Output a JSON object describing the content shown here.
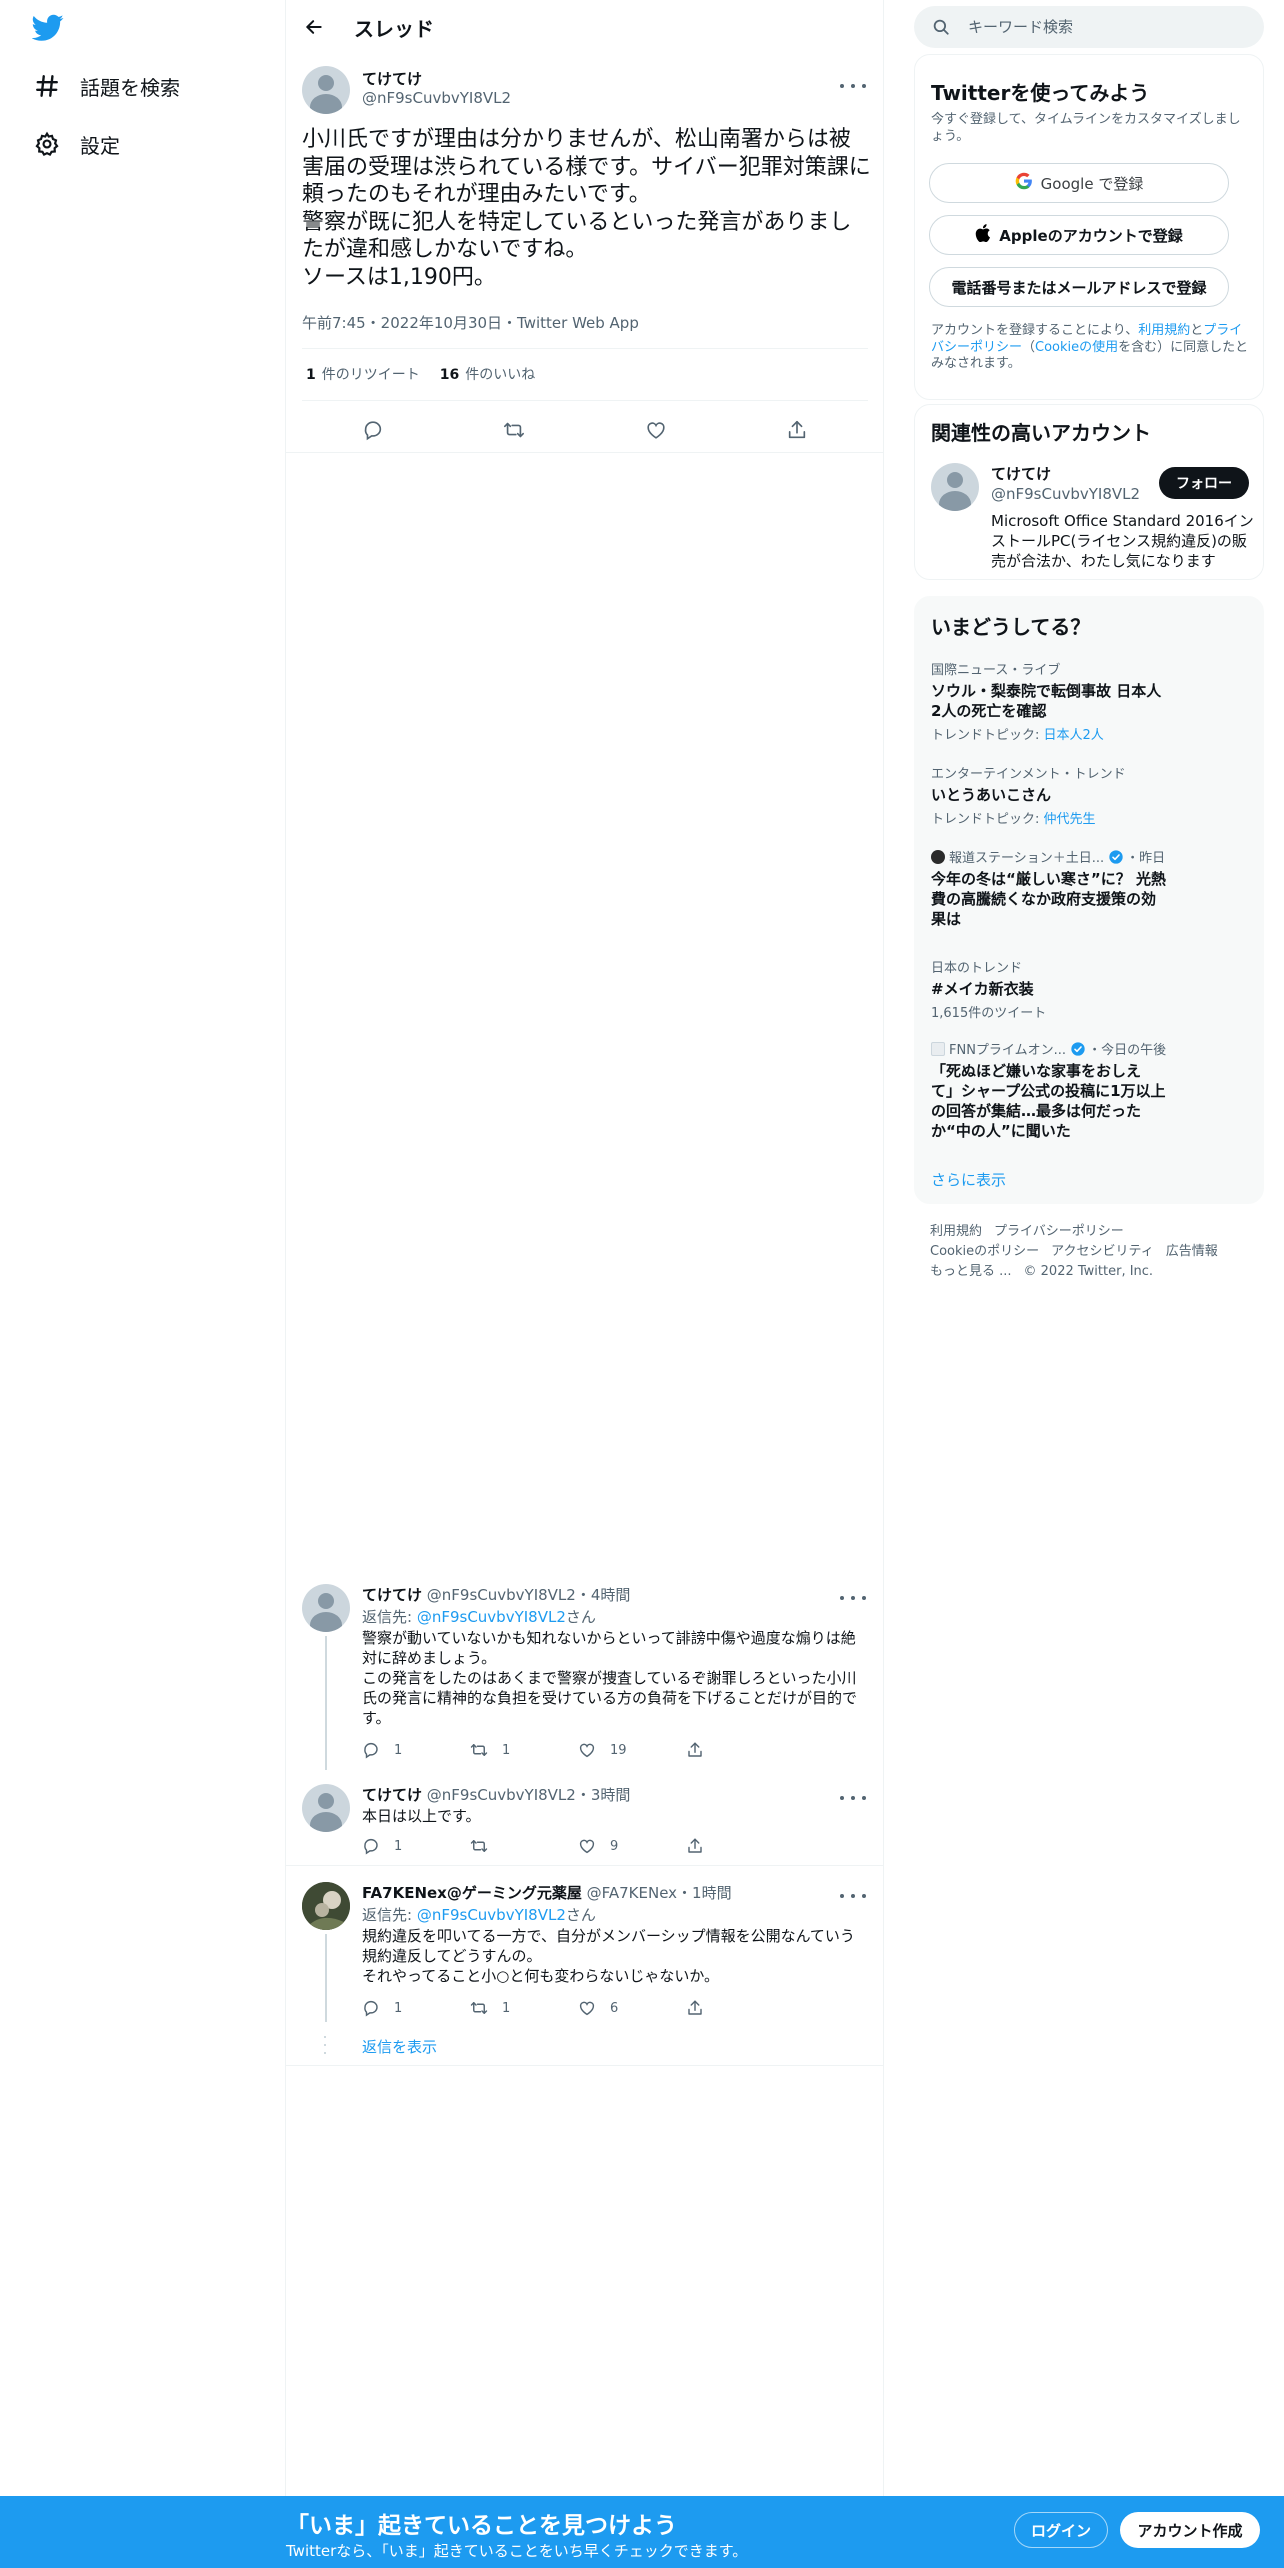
{
  "nav": {
    "logo_icon": "twitter-bird-icon",
    "explore_label": "話題を検索",
    "settings_label": "設定"
  },
  "header": {
    "title": "スレッド"
  },
  "tweet": {
    "name": "てけてけ",
    "handle": "@nF9sCuvbvYI8VL2",
    "text": "小川氏ですが理由は分かりませんが、松山南署からは被害届の受理は渋られている様です。サイバー犯罪対策課に頼ったのもそれが理由みたいです。\n警察が既に犯人を特定しているといった発言がありましたが違和感しかないですね。\nソースは1,190円。",
    "meta": "午前7:45・2022年10月30日・Twitter Web App",
    "retweets": "1",
    "retweets_label": "件のリツイート",
    "likes": "16",
    "likes_label": "件のいいね"
  },
  "replies": [
    {
      "name": "てけてけ",
      "meta": " @nF9sCuvbvYI8VL2・4時間",
      "replyto_prefix": "返信先: ",
      "replyto_handle": "@nF9sCuvbvYI8VL2",
      "replyto_suffix": "さん",
      "text": "警察が動いていないかも知れないからといって誹謗中傷や過度な煽りは絶対に辞めましょう。\nこの発言をしたのはあくまで警察が捜査しているぞ謝罪しろといった小川氏の発言に精神的な負担を受けている方の負荷を下げることだけが目的です。",
      "replies": "1",
      "retweets": "1",
      "likes": "19"
    },
    {
      "name": "てけてけ",
      "meta": " @nF9sCuvbvYI8VL2・3時間",
      "text": "本日は以上です。",
      "replies": "1",
      "retweets": "",
      "likes": "9"
    },
    {
      "name": "FA7KENex@ゲーミング元薬屋",
      "meta": " @FA7KENex・1時間",
      "replyto_prefix": "返信先: ",
      "replyto_handle": "@nF9sCuvbvYI8VL2",
      "replyto_suffix": "さん",
      "text": "規約違反を叩いてる一方で、自分がメンバーシップ情報を公開なんていう規約違反してどうすんの。\nそれやってること小○と何も変わらないじゃないか。",
      "replies": "1",
      "retweets": "1",
      "likes": "6"
    }
  ],
  "show_replies": "返信を表示",
  "search": {
    "placeholder": "キーワード検索"
  },
  "signup": {
    "title": "Twitterを使ってみよう",
    "subtitle": "今すぐ登録して、タイムラインをカスタマイズしましょう。",
    "google_label": "Google で登録",
    "apple_label": "Appleのアカウントで登録",
    "phone_label": "電話番号またはメールアドレスで登録",
    "legal_pre": "アカウントを登録することにより、",
    "legal_terms": "利用規約",
    "legal_and": "と",
    "legal_privacy": "プライバシーポリシー",
    "legal_paren_open": "（",
    "legal_cookie": "Cookieの使用",
    "legal_post": "を含む）に同意したとみなされます。"
  },
  "related": {
    "title": "関連性の高いアカウント",
    "name": "てけてけ",
    "handle": "@nF9sCuvbvYI8VL2",
    "follow_label": "フォロー",
    "bio": "Microsoft Office Standard 2016インストールPC(ライセンス規約違反)の販売が合法か、わたし気になります"
  },
  "trends": {
    "title": "いまどうしてる？",
    "items": [
      {
        "context": "国際ニュース・ライブ",
        "title": "ソウル・梨泰院で転倒事故 日本人\n2人の死亡を確認",
        "sub_prefix": "トレンドトピック: ",
        "sub_link": "日本人2人"
      },
      {
        "context": "エンターテインメント・トレンド",
        "title": "いとうあいこさん",
        "sub_prefix": "トレンドトピック: ",
        "sub_link": "仲代先生"
      },
      {
        "context": "報道ステーション＋土日...",
        "time": "・昨日",
        "title": "今年の冬は“厳しい寒さ”に？ 光熱\n費の高騰続くなか政府支援策の効\n果は"
      },
      {
        "context": "日本のトレンド",
        "title": "#メイカ新衣装",
        "sub": "1,615件のツイート"
      },
      {
        "context": "FNNプライムオン...",
        "time": "・今日の午後",
        "title": "「死ぬほど嫌いな家事をおしえ\nて」シャープ公式の投稿に1万以上\nの回答が集結…最多は何だった\nか“中の人”に聞いた"
      }
    ],
    "show_more": "さらに表示"
  },
  "footer": {
    "terms": "利用規約",
    "privacy": "プライバシーポリシー",
    "cookie": "Cookieのポリシー",
    "accessibility": "アクセシビリティ",
    "ads": "広告情報",
    "more": "もっと見る ...",
    "copyright": "© 2022 Twitter, Inc."
  },
  "bottombar": {
    "title": "「いま」起きていることを見つけよう",
    "subtitle": "Twitterなら、「いま」起きていることをいち早くチェックできます。",
    "login_label": "ログイン",
    "signup_label": "アカウント作成"
  },
  "colors": {
    "accent": "#1d9bf0",
    "text": "#0f1419",
    "secondary": "#536471"
  }
}
